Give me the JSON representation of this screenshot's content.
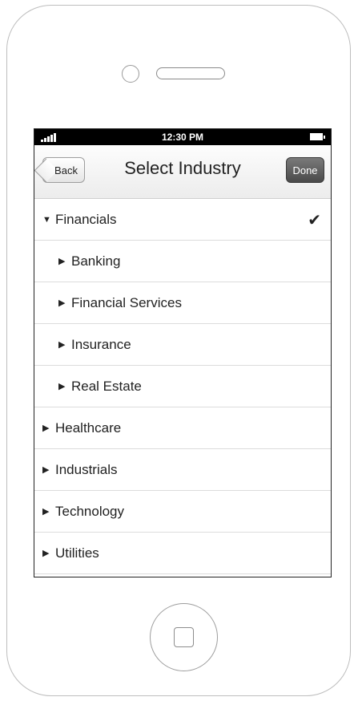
{
  "status_bar": {
    "time": "12:30 PM"
  },
  "nav": {
    "back_label": "Back",
    "title": "Select Industry",
    "done_label": "Done"
  },
  "list": {
    "items": [
      {
        "label": "Financials",
        "icon": "triangle-down-icon",
        "checked": true
      },
      {
        "label": "Banking",
        "icon": "triangle-right-icon"
      },
      {
        "label": "Financial Services",
        "icon": "triangle-right-icon"
      },
      {
        "label": "Insurance",
        "icon": "triangle-right-icon"
      },
      {
        "label": "Real Estate",
        "icon": "triangle-right-icon"
      },
      {
        "label": "Healthcare",
        "icon": "triangle-right-icon"
      },
      {
        "label": "Industrials",
        "icon": "triangle-right-icon"
      },
      {
        "label": "Technology",
        "icon": "triangle-right-icon"
      },
      {
        "label": "Utilities",
        "icon": "triangle-right-icon"
      }
    ]
  },
  "colors": {
    "done_button": "#555555",
    "status_bar": "#000000"
  }
}
